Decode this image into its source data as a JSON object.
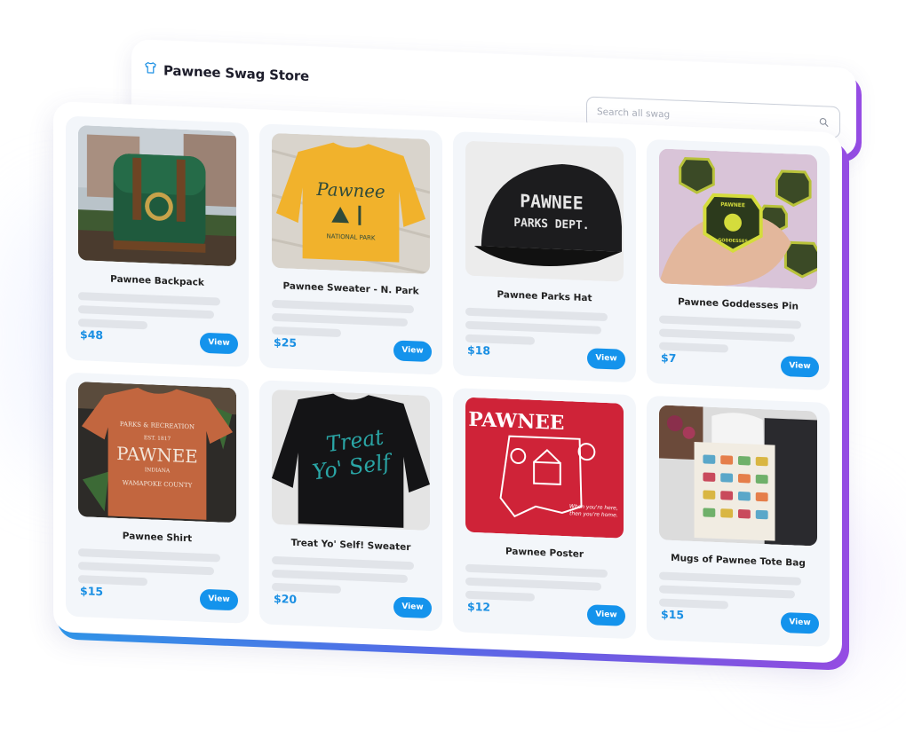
{
  "header": {
    "title": "Pawnee Swag Store",
    "logo_icon": "tshirt-icon",
    "search_placeholder": "Search all swag",
    "search_icon": "search-icon"
  },
  "colors": {
    "accent": "#1493ec",
    "price": "#1a8fe3",
    "gradient_start": "#2d9cf0",
    "gradient_end": "#9a4de8"
  },
  "products": [
    {
      "name": "Pawnee Backpack",
      "price": "$48",
      "action": "View"
    },
    {
      "name": "Pawnee Sweater - N. Park",
      "price": "$25",
      "action": "View"
    },
    {
      "name": "Pawnee Parks Hat",
      "price": "$18",
      "action": "View"
    },
    {
      "name": "Pawnee Goddesses Pin",
      "price": "$7",
      "action": "View"
    },
    {
      "name": "Pawnee Shirt",
      "price": "$15",
      "action": "View"
    },
    {
      "name": "Treat Yo' Self! Sweater",
      "price": "$20",
      "action": "View"
    },
    {
      "name": "Pawnee Poster",
      "price": "$12",
      "action": "View"
    },
    {
      "name": "Mugs of Pawnee Tote Bag",
      "price": "$15",
      "action": "View"
    }
  ],
  "artwork": {
    "sweater": "Pawnee",
    "sweater_sub": "NATIONAL PARK",
    "hat_line1": "PAWNEE",
    "hat_line2": "PARKS DEPT.",
    "pin_top": "PAWNEE",
    "pin_bottom": "GODDESSES",
    "shirt_top": "PARKS & RECREATION",
    "shirt_est": "EST. 1817",
    "shirt_main": "PAWNEE",
    "shirt_state": "INDIANA",
    "shirt_bottom": "WAMAPOKE COUNTY",
    "treat_line1": "Treat",
    "treat_line2": "Yo' Self",
    "poster_title": "PAWNEE",
    "poster_tagline1": "When you're here,",
    "poster_tagline2": "then you're home."
  }
}
